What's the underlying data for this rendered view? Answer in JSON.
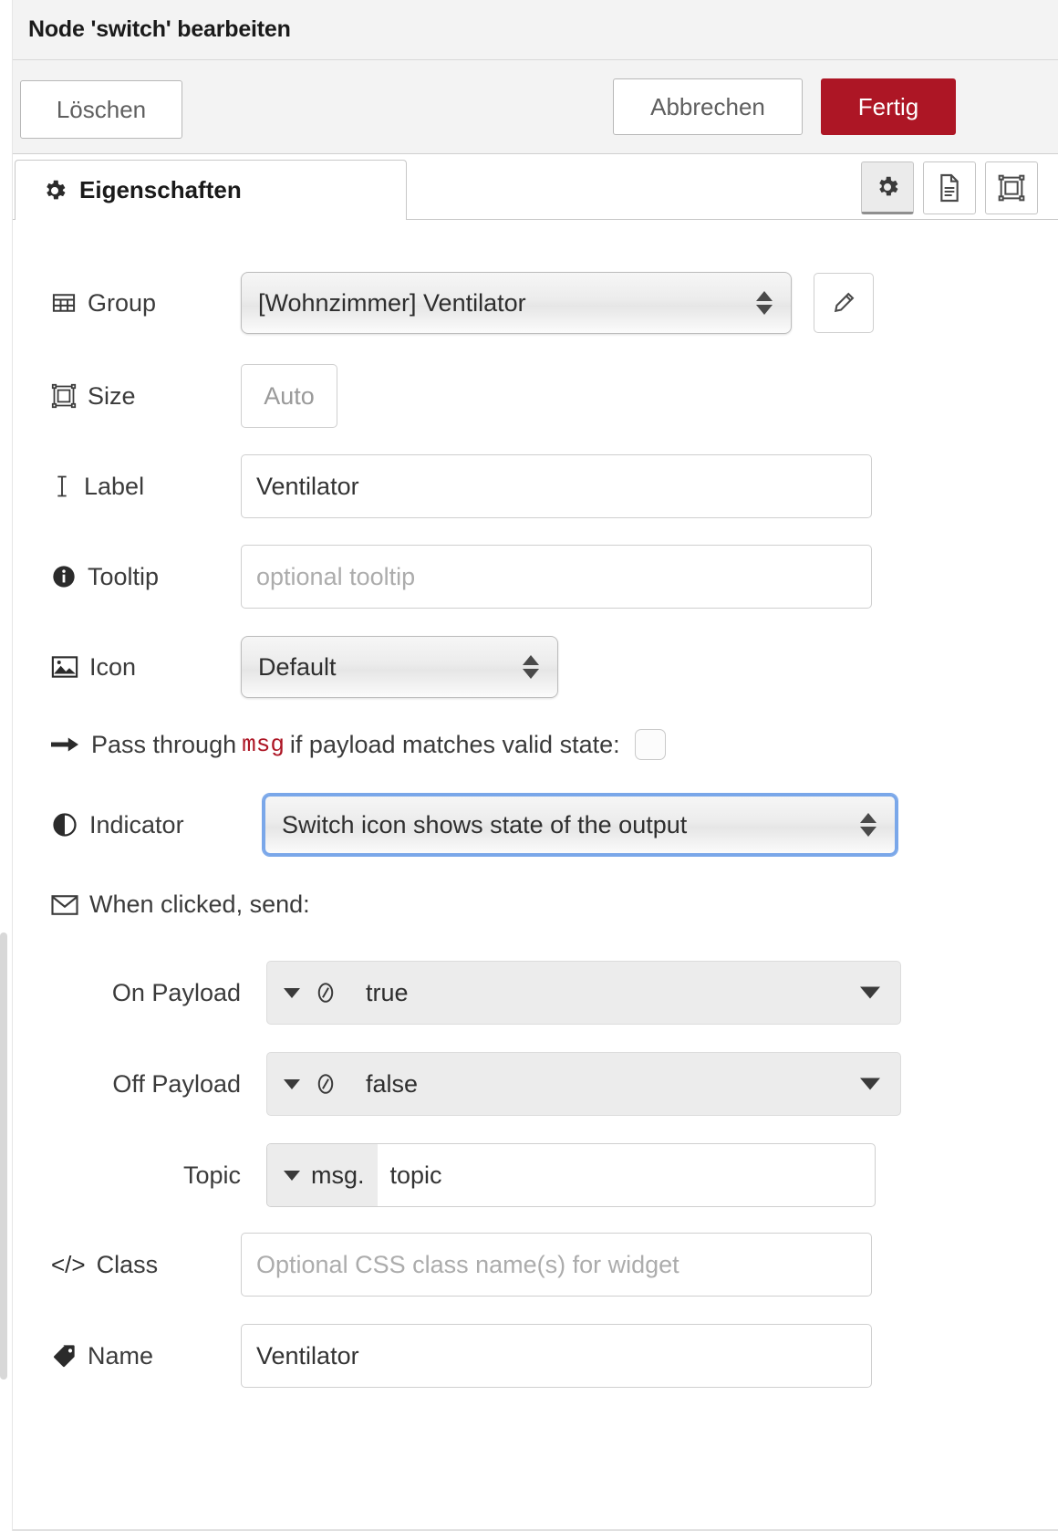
{
  "dialog": {
    "title": "Node 'switch' bearbeiten",
    "buttons": {
      "delete": "Löschen",
      "cancel": "Abbrechen",
      "done": "Fertig"
    },
    "accent_color": "#ad1625"
  },
  "tabs": {
    "active_tab": "Eigenschaften",
    "icon_buttons": [
      {
        "name": "gear-icon",
        "active": true
      },
      {
        "name": "document-icon",
        "active": false
      },
      {
        "name": "layout-icon",
        "active": false
      }
    ]
  },
  "form": {
    "group": {
      "label": "Group",
      "icon": "table-icon",
      "value": "[Wohnzimmer] Ventilator",
      "edit_button_icon": "pencil-icon"
    },
    "size": {
      "label": "Size",
      "icon": "resize-icon",
      "value": "Auto"
    },
    "label_field": {
      "label": "Label",
      "icon": "text-cursor-icon",
      "value": "Ventilator"
    },
    "tooltip": {
      "label": "Tooltip",
      "icon": "info-icon",
      "value": "",
      "placeholder": "optional tooltip"
    },
    "icon_field": {
      "label": "Icon",
      "icon": "image-icon",
      "value": "Default"
    },
    "pass_through": {
      "icon": "arrow-right-icon",
      "text_before": "Pass through",
      "code": "msg",
      "text_after": "if payload matches valid state:",
      "checked": false
    },
    "indicator": {
      "label": "Indicator",
      "icon": "contrast-icon",
      "value": "Switch icon shows state of the output",
      "focused": true
    },
    "when_clicked": {
      "icon": "envelope-icon",
      "text": "When clicked, send:"
    },
    "on_payload": {
      "label": "On Payload",
      "type_icon": "boolean-icon",
      "value": "true"
    },
    "off_payload": {
      "label": "Off Payload",
      "type_icon": "boolean-icon",
      "value": "false"
    },
    "topic": {
      "label": "Topic",
      "prefix": "msg.",
      "value": "topic"
    },
    "class_field": {
      "label": "Class",
      "icon": "code-icon",
      "icon_text": "</>",
      "value": "",
      "placeholder": "Optional CSS class name(s) for widget"
    },
    "name": {
      "label": "Name",
      "icon": "tag-icon",
      "value": "Ventilator"
    }
  }
}
